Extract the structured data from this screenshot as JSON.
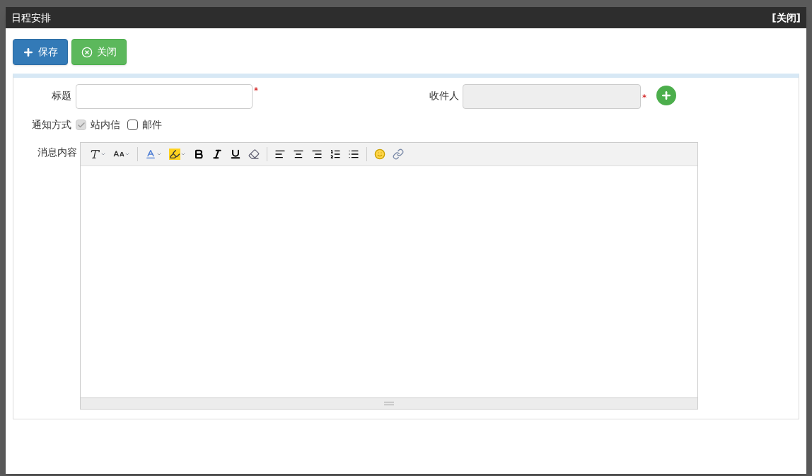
{
  "window": {
    "title": "日程安排",
    "close_link": "[关闭]"
  },
  "toolbar": [
    {
      "kind": "save",
      "label": "保存"
    },
    {
      "kind": "close",
      "label": "关闭"
    }
  ],
  "form": {
    "title_field": {
      "label": "标题",
      "required_mark": "*"
    },
    "recipient_field": {
      "label": "收件人",
      "disabled": true,
      "required_mark": "*"
    },
    "notify": {
      "label": "通知方式",
      "options": [
        {
          "label": "站内信",
          "checked": true,
          "disabled": true
        },
        {
          "label": "邮件",
          "checked": false,
          "disabled": false
        }
      ]
    },
    "message": {
      "label": "消息内容"
    }
  }
}
